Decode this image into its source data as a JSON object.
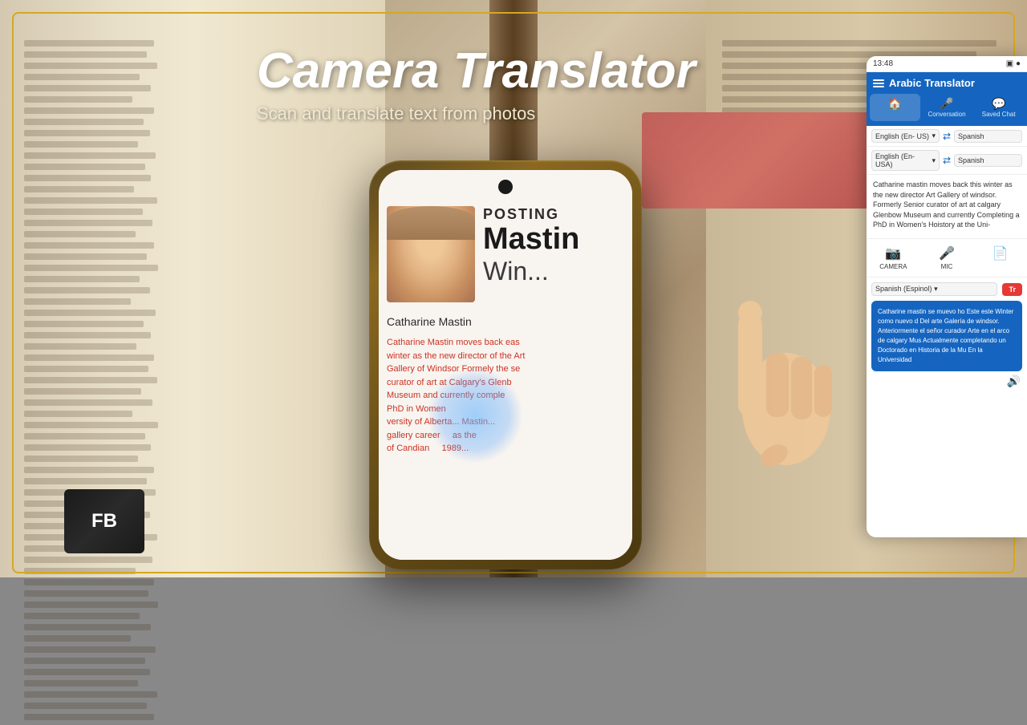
{
  "background": {
    "color": "#b8a07a"
  },
  "frame": {
    "border_color": "#d4a820"
  },
  "heading": {
    "main_title": "Camera Translator",
    "sub_title": "Scan and translate text from photos"
  },
  "phone": {
    "posting_label": "POSTING",
    "name_large": "Mastin",
    "name_detail": "Win...",
    "author_name": "Catharine Mastin",
    "body_text_lines": [
      "Catharine Mastin moves back eas",
      "winter as the new director of the Art",
      "Gallery of Windsor Formely the se",
      "curator of art at Calgary's Glenb",
      "Museum and currently comple",
      "PhD in Women",
      "versity of Alberta... Mastin...",
      "gallery career       as the",
      "of Candian       1989..."
    ]
  },
  "app_panel": {
    "status_bar": {
      "time": "13:48",
      "icons": [
        "battery",
        "signal"
      ]
    },
    "toolbar": {
      "title": "Arabic Translator"
    },
    "nav_tabs": [
      {
        "label": "",
        "icon": "🏠",
        "active": true
      },
      {
        "label": "Conversation",
        "icon": "🎤"
      },
      {
        "label": "Saved Chat",
        "icon": "💬"
      }
    ],
    "lang_rows": [
      {
        "from": "English (En- US)",
        "to": "Spanish"
      },
      {
        "from": "English (En- USA)",
        "to": "Spanish"
      }
    ],
    "translation_text": "Catharine mastin moves back this winter as the new director Art Gallery of windsor. Formerly Senior curator of art at calgary Glenbow Museum and currently Completing a PhD in Women's Hoistory at the Uni-",
    "action_buttons": [
      {
        "label": "CAMERA",
        "icon": "📷"
      },
      {
        "label": "MIC",
        "icon": "🎤"
      },
      {
        "label": "",
        "icon": "📄"
      }
    ],
    "translate_lang": "Spanish (Espinol)",
    "translate_btn_label": "Tr",
    "result_text": "Catharine mastin se muevo ho Este este Winter como nuevo d Del arte Galería de windsor. Anteriormente el señor curador Arte en el arco de calgary Mus Actualmente completando un Doctorado en Historia de la Mu En la Universidad",
    "speaker_icon": "🔊"
  }
}
